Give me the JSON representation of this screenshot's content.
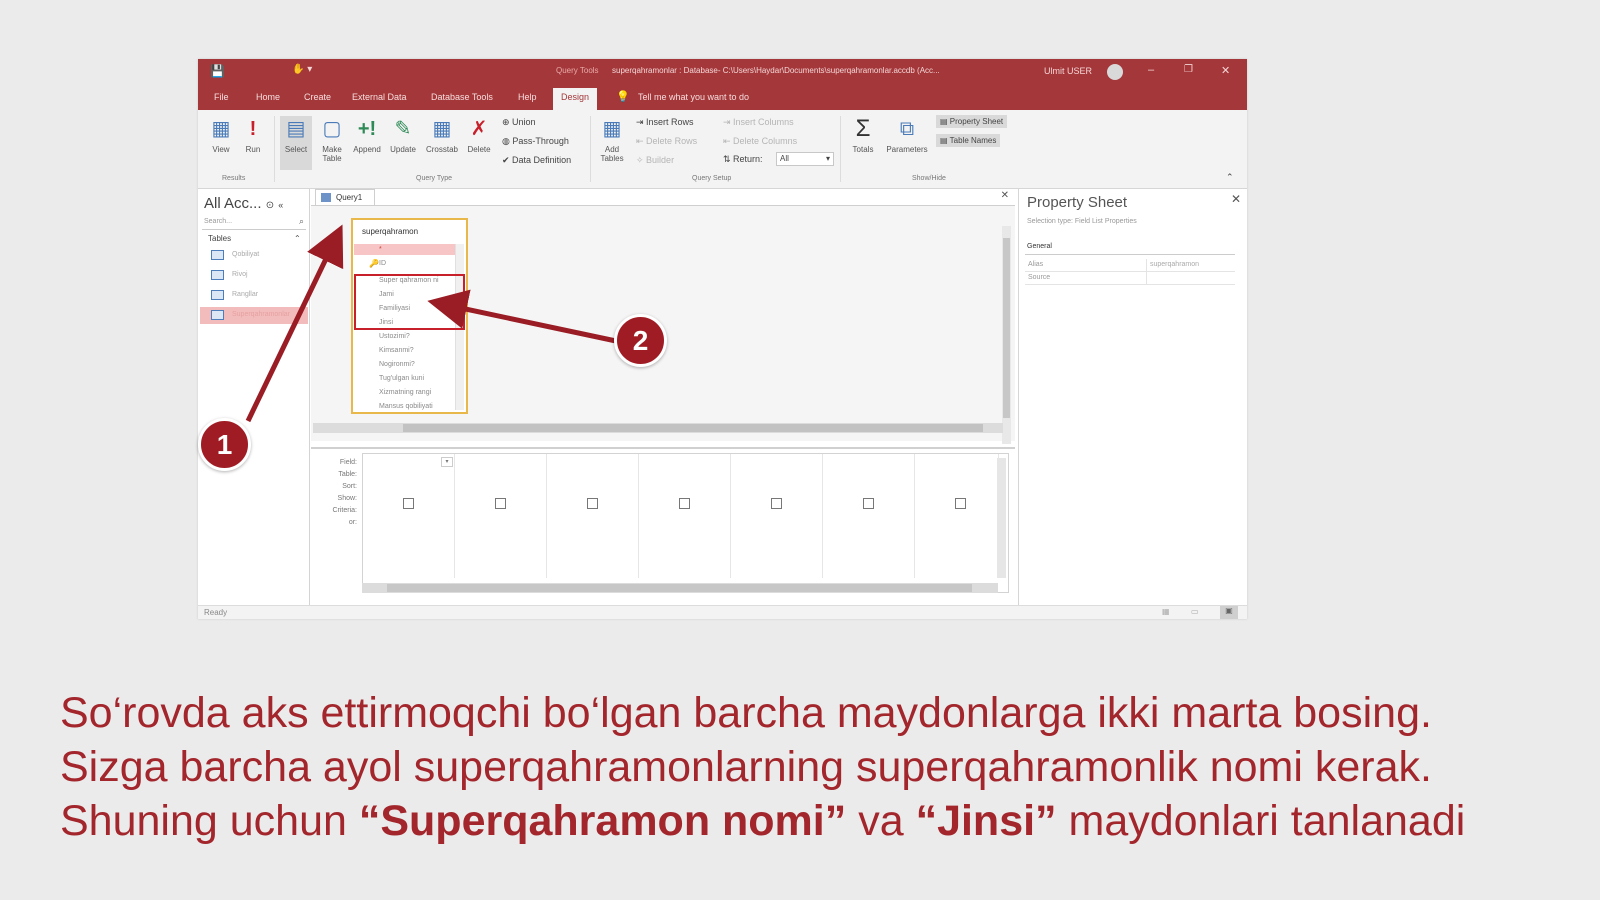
{
  "window": {
    "title": "superqahramonlar : Database- C:\\Users\\Haydar\\Documents\\superqahramonlar.accdb (Acc...",
    "context_tab": "Query Tools",
    "user": "Ulmit USER",
    "controls": {
      "minimize": "–",
      "restore": "❐",
      "close": "✕"
    }
  },
  "ribbon": {
    "tabs": [
      "File",
      "Home",
      "Create",
      "External Data",
      "Database Tools",
      "Help",
      "Design"
    ],
    "active_tab": "Design",
    "tell_me": "Tell me what you want to do",
    "buttons": {
      "view": "View",
      "run": "Run",
      "select": "Select",
      "make_table": "Make Table",
      "append": "Append",
      "update": "Update",
      "crosstab": "Crosstab",
      "delete": "Delete",
      "union": "Union",
      "pass_through": "Pass-Through",
      "data_definition": "Data Definition",
      "add_tables": "Add Tables",
      "insert_rows": "Insert Rows",
      "delete_rows": "Delete Rows",
      "builder": "Builder",
      "insert_columns": "Insert Columns",
      "delete_columns": "Delete Columns",
      "return_label": "Return:",
      "return_value": "All",
      "totals": "Totals",
      "parameters": "Parameters",
      "property_sheet": "Property Sheet",
      "table_names": "Table Names"
    },
    "groups": {
      "results": "Results",
      "query_type": "Query Type",
      "query_setup": "Query Setup",
      "show_hide": "Show/Hide"
    }
  },
  "nav": {
    "title": "All Acc...",
    "search_placeholder": "Search...",
    "group": "Tables",
    "items": [
      "Qobiliyat",
      "Rivoj",
      "Rangllar",
      "Superqahramonlar"
    ]
  },
  "design": {
    "query_tab": "Query1",
    "table": {
      "name": "superqahramon",
      "star": "*",
      "fields": [
        "ID",
        "Super qahramon ni",
        "Jami",
        "Familiyasi",
        "Jinsi",
        "Ustozimi?",
        "Kimsanmi?",
        "Nogironmi?",
        "Tug'ulgan kuni",
        "Xizmatning rangi",
        "Mansus qobiliyati"
      ]
    },
    "grid_rows": [
      "Field:",
      "Table:",
      "Sort:",
      "Show:",
      "Criteria:",
      "or:"
    ]
  },
  "property_sheet": {
    "title": "Property Sheet",
    "subtitle": "Selection type: Field List Properties",
    "section": "General",
    "rows": [
      {
        "label": "Alias",
        "value": "superqahramon"
      },
      {
        "label": "Source",
        "value": ""
      }
    ]
  },
  "status": "Ready",
  "callouts": [
    "1",
    "2"
  ],
  "caption": {
    "line1": "So‘rovda aks ettirmoqchi bo‘lgan barcha maydonlarga ikki marta bosing.",
    "line2": "Sizga barcha ayol superqahramonlarning superqahramonlik nomi kerak.",
    "line3_prefix": "Shuning uchun ",
    "bold1": "“Superqahramon nomi”",
    "line3_mid": " va ",
    "bold2": "“Jinsi”",
    "line3_suffix": " maydonlari tanlanadi"
  },
  "colors": {
    "accent": "#a4373a",
    "callout": "#a01c24",
    "caption": "#a3262c",
    "highlight_box": "#c8202b",
    "table_border": "#e9b84a"
  }
}
